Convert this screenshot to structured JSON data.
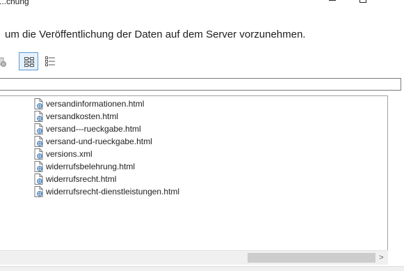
{
  "window": {
    "title": "...chung",
    "minimize_icon": "minimize-icon",
    "maximize_icon": "maximize-icon"
  },
  "description": "um die Veröffentlichung der Daten auf dem Server vorzunehmen.",
  "toolbar": {
    "buttons": [
      {
        "icon": "publish-partial-icon"
      },
      {
        "icon": "tree-view-icon",
        "active": true
      },
      {
        "icon": "list-view-icon",
        "active": false
      }
    ]
  },
  "filter": {
    "value": ""
  },
  "files": [
    "versandinformationen.html",
    "versandkosten.html",
    "versand---rueckgabe.html",
    "versand-und-rueckgabe.html",
    "versions.xml",
    "widerrufsbelehrung.html",
    "widerrufsrecht.html",
    "widerrufsrecht-dienstleistungen.html"
  ],
  "scrollbar": {
    "right_arrow": ">"
  },
  "colors": {
    "accent": "#5b9bd5",
    "file_icon_globe": "#2b6cb0"
  }
}
